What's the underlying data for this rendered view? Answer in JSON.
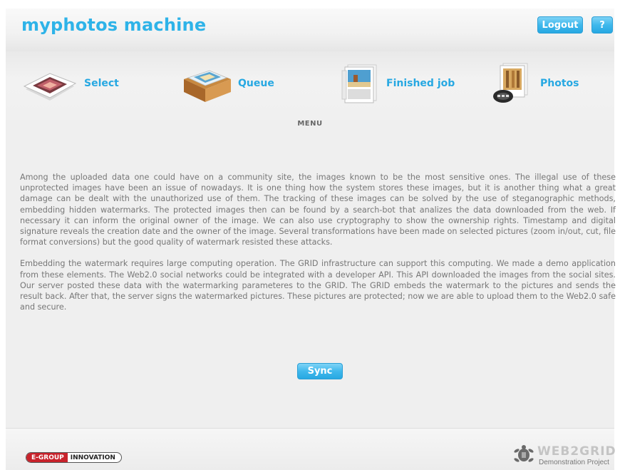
{
  "header": {
    "title": "myphotos machine",
    "logout_label": "Logout",
    "help_label": "?"
  },
  "nav": {
    "items": [
      {
        "label": "Select",
        "icon": "photo-slide-icon"
      },
      {
        "label": "Queue",
        "icon": "photo-tray-icon"
      },
      {
        "label": "Finished job",
        "icon": "photo-stack-icon"
      },
      {
        "label": "Photos",
        "icon": "film-photos-icon"
      }
    ]
  },
  "menu_heading": "MENU",
  "content": {
    "paragraphs": [
      "Among the uploaded data one could have on a community site, the images known to be the most sensitive ones. The illegal use of these unprotected images have been an issue of nowadays. It is one thing how the system stores these images, but it is another thing what a great damage can be dealt with the unauthorized use of them. The tracking of these images can be solved by the use of steganographic methods, embedding hidden watermarks. The protected images then can be found by a search-bot that analizes the data downloaded from the web. If necessary it can inform the original owner of the image. We can also use cryptography to show the ownership rights. Timestamp and digital signature reveals the creation date and the owner of the image. Several transformations have been made on selected pictures (zoom in/out, cut, file format conversions) but the good quality of watermark resisted these attacks.",
      "Embedding the watermark requires large computing operation. The GRID infrastructure can support this computing. We made a demo application from these elements. The Web2.0 social networks could be integrated with a developer API. This API downloaded the images from the social sites. Our server posted these data with the watermarking parameteres to the GRID. The GRID embeds the watermark to the pictures and sends the result back. After that, the server signs the watermarked pictures. These pictures are protected; now we are able to upload them to the Web2.0 safe and secure."
    ]
  },
  "sync_label": "Sync",
  "footer": {
    "egroup_left": "E-GROUP",
    "egroup_right": "INNOVATION",
    "web2grid_title": "WEB2GRID",
    "web2grid_subtitle": "Demonstration Project"
  },
  "colors": {
    "accent": "#27a8e2",
    "brand_red": "#c8232c",
    "text": "#777777"
  }
}
